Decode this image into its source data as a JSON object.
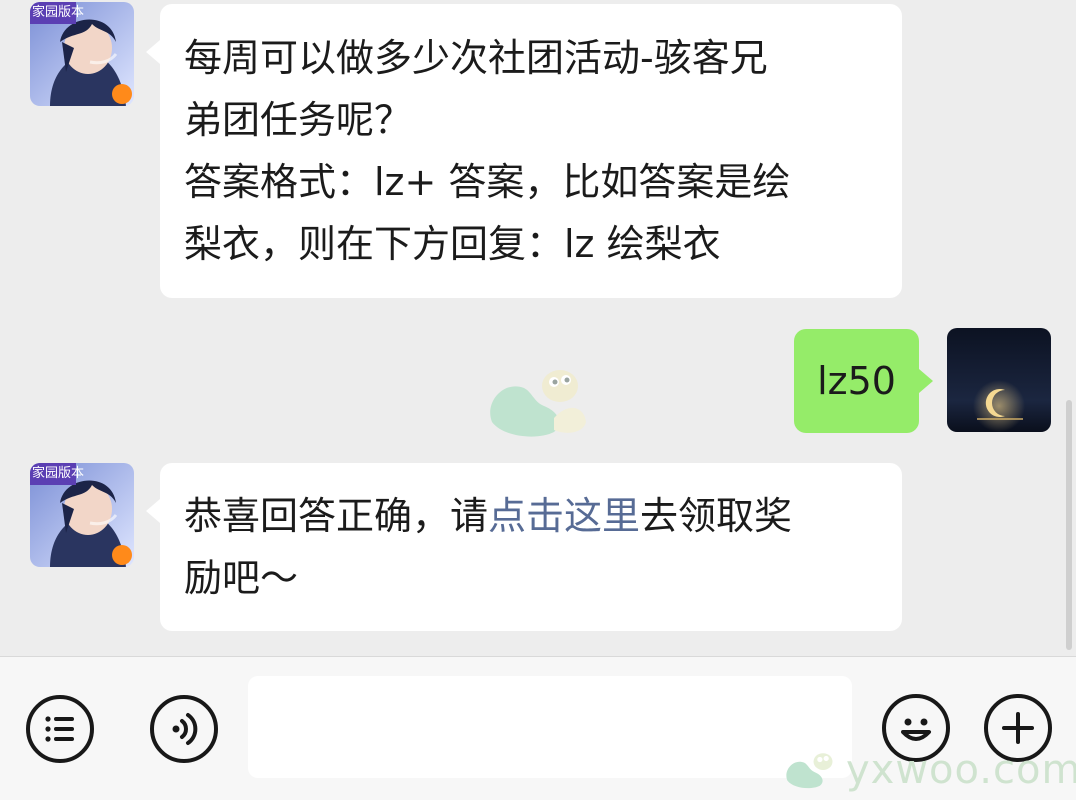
{
  "messages": [
    {
      "sender": "official-account",
      "avatar_badge": "家园版本",
      "lines": [
        "每周可以做多少次社团活动-骇客兄",
        "弟团任务呢？",
        "答案格式：lz+ 答案，比如答案是绘",
        "梨衣，则在下方回复：lz 绘梨衣"
      ]
    },
    {
      "sender": "me",
      "text": "lz50"
    },
    {
      "sender": "official-account",
      "avatar_badge": "家园版本",
      "line1_before": "恭喜回答正确，请",
      "line1_link": "点击这里",
      "line1_after": "去领取奖",
      "line2": "励吧～"
    }
  ],
  "toolbar": {
    "menu_icon": "list-icon",
    "voice_icon": "voice-icon",
    "input_value": "",
    "emoji_icon": "smiley-icon",
    "add_icon": "plus-icon"
  },
  "watermark": {
    "text": "yxwoo.com"
  },
  "colors": {
    "background": "#ededed",
    "bubble_received": "#ffffff",
    "bubble_sent": "#95ec69",
    "link": "#576b95"
  }
}
